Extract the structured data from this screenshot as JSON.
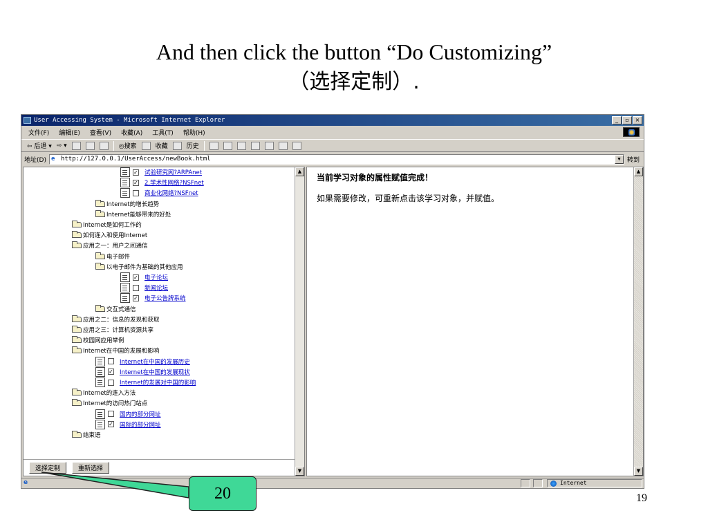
{
  "slide": {
    "title_line1": "And then click the button “Do Customizing”",
    "title_line2": "（选择定制）.",
    "page_number": "19",
    "callout": "20"
  },
  "window": {
    "title": "User Accessing System - Microsoft Internet Explorer",
    "controls": [
      "_",
      "▫",
      "×"
    ],
    "menu": [
      "文件(F)",
      "编辑(E)",
      "查看(V)",
      "收藏(A)",
      "工具(T)",
      "帮助(H)"
    ],
    "toolbar": {
      "back": "⇦ 后退 ▾",
      "forward": "⇨ ▾",
      "search": "◎搜索",
      "favorites": "收藏",
      "history": "历史"
    },
    "address_label": "地址(D)",
    "address_url": "http://127.0.0.1/UserAccess/newBook.html",
    "go_label": "转到",
    "status_zone": "Internet"
  },
  "tree": [
    {
      "type": "doc",
      "indent": 140,
      "checked": true,
      "text": "试验研究网?ARPAnet"
    },
    {
      "type": "doc",
      "indent": 140,
      "checked": true,
      "text": "2.学术性网络?NSFnet"
    },
    {
      "type": "doc",
      "indent": 140,
      "checked": false,
      "text": "商业化网络?NSFnet"
    },
    {
      "type": "folder",
      "indent": 104,
      "text": "Internet的增长趋势"
    },
    {
      "type": "folder",
      "indent": 104,
      "text": "Internet能够带来的好处"
    },
    {
      "type": "folder",
      "indent": 70,
      "text": "Internet是如何工作的"
    },
    {
      "type": "folder",
      "indent": 70,
      "text": "如何连入和使用Internet"
    },
    {
      "type": "folder",
      "indent": 70,
      "text": "应用之一：用户之间通信"
    },
    {
      "type": "folder",
      "indent": 104,
      "text": "电子邮件"
    },
    {
      "type": "folder",
      "indent": 104,
      "text": "以电子邮件为基础的其他应用"
    },
    {
      "type": "doc",
      "indent": 140,
      "checked": true,
      "text": "电子论坛"
    },
    {
      "type": "doc",
      "indent": 140,
      "checked": false,
      "text": "新闻论坛"
    },
    {
      "type": "doc",
      "indent": 140,
      "checked": true,
      "text": "电子公告牌系统"
    },
    {
      "type": "folder",
      "indent": 104,
      "text": "交互式通信"
    },
    {
      "type": "folder",
      "indent": 70,
      "text": "应用之二：信息的发现和获取"
    },
    {
      "type": "folder",
      "indent": 70,
      "text": "应用之三：计算机资源共享"
    },
    {
      "type": "folder",
      "indent": 70,
      "text": "校园网应用举例"
    },
    {
      "type": "folder",
      "indent": 70,
      "text": "Internet在中国的发展和影响"
    },
    {
      "type": "doc",
      "indent": 104,
      "checked": false,
      "text": "Internet在中国的发展历史"
    },
    {
      "type": "doc",
      "indent": 104,
      "checked": true,
      "text": "Internet在中国的发展现状"
    },
    {
      "type": "doc",
      "indent": 104,
      "checked": false,
      "text": "Internet的发展对中国的影响"
    },
    {
      "type": "folder",
      "indent": 70,
      "text": "Internet的连入方法"
    },
    {
      "type": "folder",
      "indent": 70,
      "text": "Internet的访问热门站点"
    },
    {
      "type": "doc",
      "indent": 104,
      "checked": false,
      "text": "国内的部分网址"
    },
    {
      "type": "doc",
      "indent": 104,
      "checked": true,
      "text": "国际的部分网址"
    },
    {
      "type": "folder",
      "indent": 70,
      "text": "结束语"
    }
  ],
  "buttons": {
    "customize": "选择定制",
    "reselect": "重新选择"
  },
  "right_panel": {
    "title": "当前学习对象的属性赋值完成！",
    "body": "如果需要修改，可重新点击该学习对象，并赋值。"
  }
}
